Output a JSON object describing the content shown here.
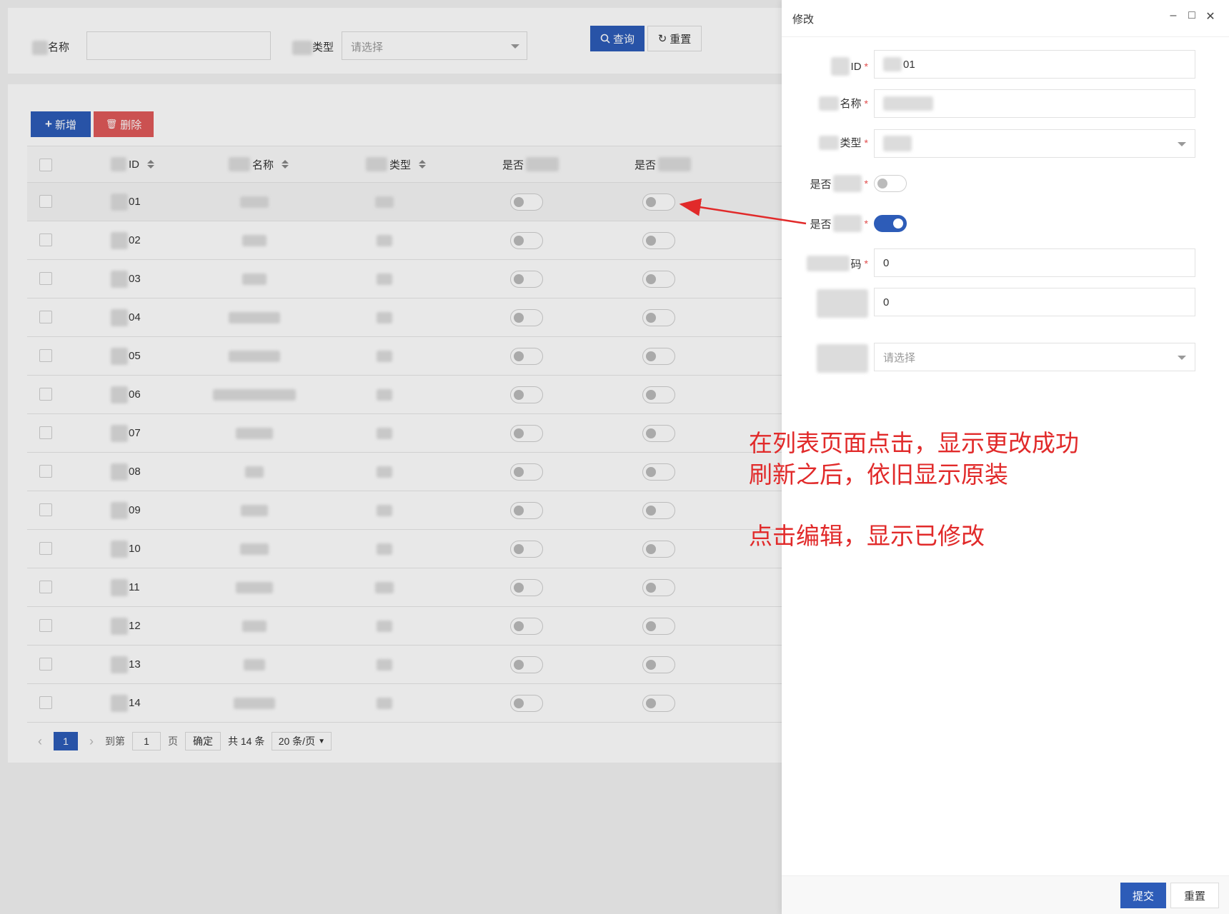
{
  "search": {
    "name_label": "名称",
    "type_label": "类型",
    "type_placeholder": "请选择",
    "query_button": "查询",
    "reset_button": "重置"
  },
  "toolbar": {
    "add_button": "新增",
    "delete_button": "删除"
  },
  "table": {
    "headers": [
      "ID",
      "名称",
      "类型",
      "是否",
      "是否"
    ],
    "ids": [
      "01",
      "02",
      "03",
      "04",
      "05",
      "06",
      "07",
      "08",
      "09",
      "10",
      "11",
      "12",
      "13",
      "14"
    ]
  },
  "pagination": {
    "current_page": "1",
    "goto_label": "到第",
    "goto_value": "1",
    "page_unit": "页",
    "confirm_button": "确定",
    "total_text": "共 14 条",
    "page_size": "20 条/页"
  },
  "drawer": {
    "title": "修改",
    "fields": {
      "id_label": "ID",
      "id_value": "01",
      "name_label": "名称",
      "type_label": "类型",
      "flag1_label": "是否",
      "flag1_value": false,
      "flag2_label": "是否",
      "flag2_value": true,
      "code_label": "码",
      "code_value": "0",
      "num_value": "0",
      "select_placeholder": "请选择"
    },
    "submit_button": "提交",
    "reset_button": "重置"
  },
  "annotation": {
    "line1": "在列表页面点击，显示更改成功",
    "line2": "刷新之后，依旧显示原装",
    "line3": "点击编辑，显示已修改",
    "color": "#e12a2a"
  }
}
